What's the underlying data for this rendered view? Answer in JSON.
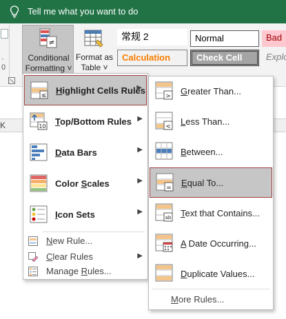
{
  "tell_me": {
    "text": "Tell me what you want to do"
  },
  "ribbon": {
    "conditional_formatting": {
      "line1": "Conditional",
      "line2": "Formatting ˅"
    },
    "format_as_table": {
      "line1": "Format as",
      "line2": "Table ˅"
    },
    "styles": {
      "chang_gui": "常规 2",
      "normal": "Normal",
      "bad": "Bad",
      "calculation": "Calculation",
      "check_cell": "Check Cell",
      "explanatory": "Explo"
    },
    "left_dots": "· 0",
    "sheet_letter": "K"
  },
  "menu1": {
    "items": [
      {
        "label": "Highlight Cells Rules",
        "access": "H",
        "icon": "highlight-cells-rules-icon",
        "selected": true
      },
      {
        "label": "Top/Bottom Rules",
        "access": "T",
        "icon": "top-bottom-rules-icon"
      },
      {
        "label": "Data Bars",
        "access": "D",
        "icon": "data-bars-icon"
      },
      {
        "label": "Color Scales",
        "access": "S",
        "icon": "color-scales-icon"
      },
      {
        "label": "Icon Sets",
        "access": "I",
        "icon": "icon-sets-icon"
      }
    ],
    "small_items": [
      {
        "label": "New Rule...",
        "icon": "new-rule-icon"
      },
      {
        "label": "Clear Rules",
        "icon": "clear-rules-icon"
      },
      {
        "label": "Manage Rules...",
        "icon": "manage-rules-icon"
      }
    ],
    "arrow": "▶"
  },
  "menu2": {
    "items": [
      {
        "label": "Greater Than...",
        "icon": "greater-than-icon"
      },
      {
        "label": "Less Than...",
        "icon": "less-than-icon"
      },
      {
        "label": "Between...",
        "icon": "between-icon"
      },
      {
        "label": "Equal To...",
        "icon": "equal-to-icon",
        "selected": true
      },
      {
        "label": "Text that Contains...",
        "icon": "text-contains-icon"
      },
      {
        "label": "A Date Occurring...",
        "icon": "date-occurring-icon"
      },
      {
        "label": "Duplicate Values...",
        "icon": "duplicate-values-icon"
      }
    ],
    "more_rules": "More Rules..."
  },
  "colors": {
    "title_bar": "#217346",
    "selected_bg": "#c6c6c6",
    "selected_border": "#9e3d3d",
    "calc_text": "#fa7d00",
    "bad_bg": "#ffc7ce",
    "bad_text": "#9c0006"
  }
}
